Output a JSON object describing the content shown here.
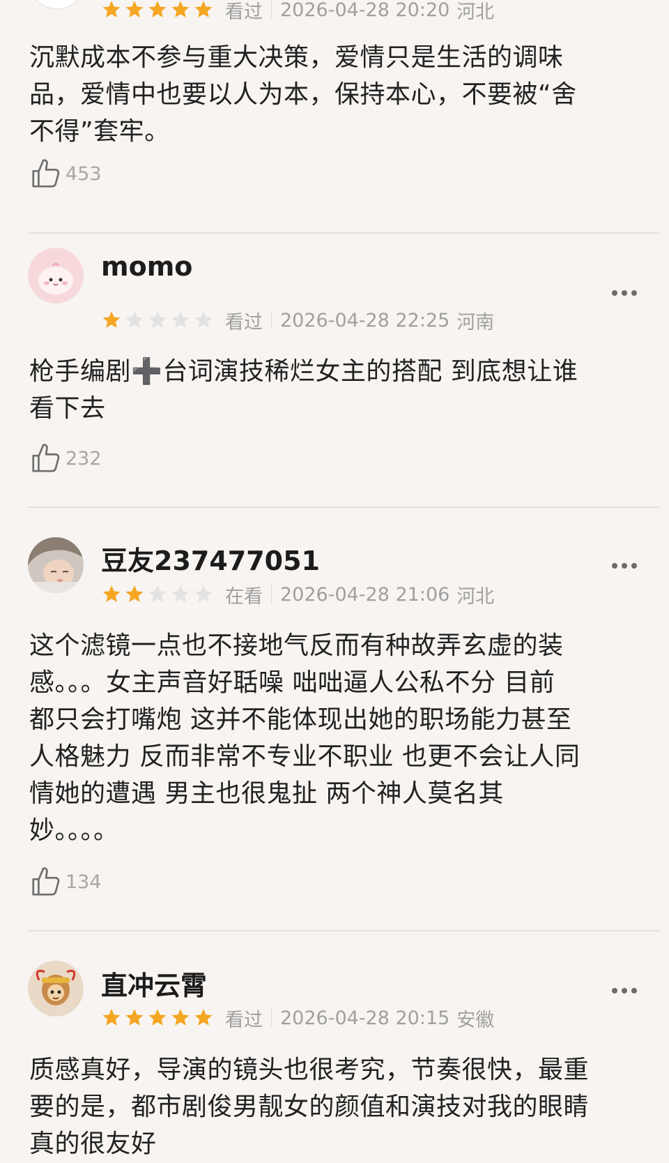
{
  "reviews": [
    {
      "username": "",
      "rating": 5,
      "status": "看过",
      "datetime": "2026-04-28 20:20",
      "location": "河北",
      "content": "沉默成本不参与重大决策，爱情只是生活的调味\n品，爱情中也要以人为本，保持本心，不要被“舍\n不得”套牢。",
      "likes": "453"
    },
    {
      "username": "momo",
      "rating": 1,
      "status": "看过",
      "datetime": "2026-04-28 22:25",
      "location": "河南",
      "content": "枪手编剧➕台词演技稀烂女主的搭配 到底想让谁\n看下去",
      "likes": "232"
    },
    {
      "username": "豆友237477051",
      "rating": 2,
      "status": "在看",
      "datetime": "2026-04-28 21:06",
      "location": "河北",
      "content": "这个滤镜一点也不接地气反而有种故弄玄虚的装\n感。。。女主声音好聒噪 咄咄逼人公私不分 目前\n都只会打嘴炮 这并不能体现出她的职场能力甚至\n人格魅力 反而非常不专业不职业 也更不会让人同\n情她的遭遇 男主也很鬼扯 两个神人莫名其\n妙。。。。",
      "likes": "134"
    },
    {
      "username": "直冲云霄",
      "rating": 5,
      "status": "看过",
      "datetime": "2026-04-28 20:15",
      "location": "安徽",
      "content": "质感真好，导演的镜头也很考究，节奏很快，最重\n要的是，都市剧俊男靓女的颜值和演技对我的眼睛\n真的很友好",
      "likes": ""
    }
  ],
  "colors": {
    "star_on": "#f5a623",
    "star_off": "#e2e2e2",
    "muted_text": "#a0a0a0",
    "background": "#f7f4f1"
  },
  "icons": {
    "like": "thumbs-up-icon",
    "more": "more-dots-icon"
  }
}
